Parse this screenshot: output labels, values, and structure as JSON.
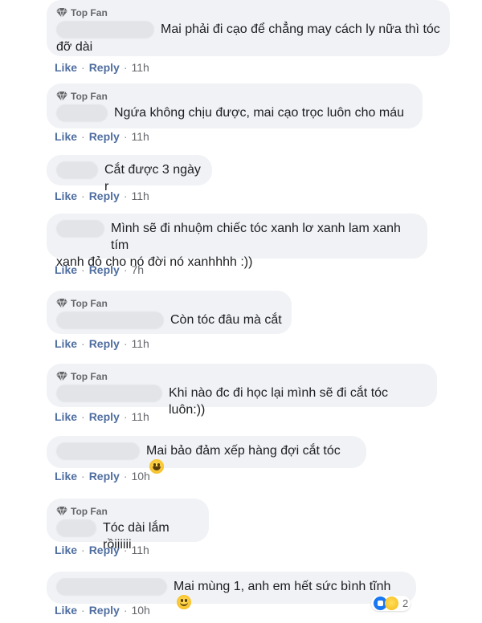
{
  "badge_label": "Top Fan",
  "actions": {
    "like": "Like",
    "reply": "Reply",
    "separator": "·"
  },
  "comments": [
    {
      "top_fan": true,
      "text_line1": "Mai phải đi cạo để chẳng may cách ly nữa thì tóc",
      "text_line2": "đỡ dài",
      "time": "11h"
    },
    {
      "top_fan": true,
      "text_line1": "Ngứa không chịu được, mai cạo trọc luôn cho máu",
      "time": "11h"
    },
    {
      "top_fan": false,
      "text_line1": "Cắt được 3 ngày r",
      "time": "11h"
    },
    {
      "top_fan": false,
      "text_line1": "Mình sẽ đi nhuộm chiếc tóc xanh lơ xanh lam xanh tím",
      "text_line2": "xanh đỏ cho nó đời nó xanhhhh :))",
      "time": "7h"
    },
    {
      "top_fan": true,
      "text_line1": "Còn tóc đâu mà cắt",
      "time": "11h"
    },
    {
      "top_fan": true,
      "text_line1": "Khi nào đc đi học lại mình sẽ đi cắt tóc luôn:))",
      "time": "11h"
    },
    {
      "top_fan": false,
      "text_line1": "Mai bảo đảm xếp hàng đợi cắt tóc",
      "emoji": "grinning-sweat-emoji",
      "time": "10h"
    },
    {
      "top_fan": true,
      "text_line1": "Tóc dài lắm rồiiiiii",
      "time": "11h"
    },
    {
      "top_fan": false,
      "text_line1": "Mai mùng 1, anh em hết sức bình tĩnh",
      "emoji": "slight-smile-emoji",
      "time": "10h",
      "reactions": {
        "icons": [
          "like-reaction-icon",
          "haha-reaction-icon"
        ],
        "count": "2"
      }
    }
  ],
  "colors": {
    "bubble": "#f0f2f5",
    "action_link": "#4f6ea0",
    "meta": "#65676b",
    "like_blue": "#1877f2"
  }
}
